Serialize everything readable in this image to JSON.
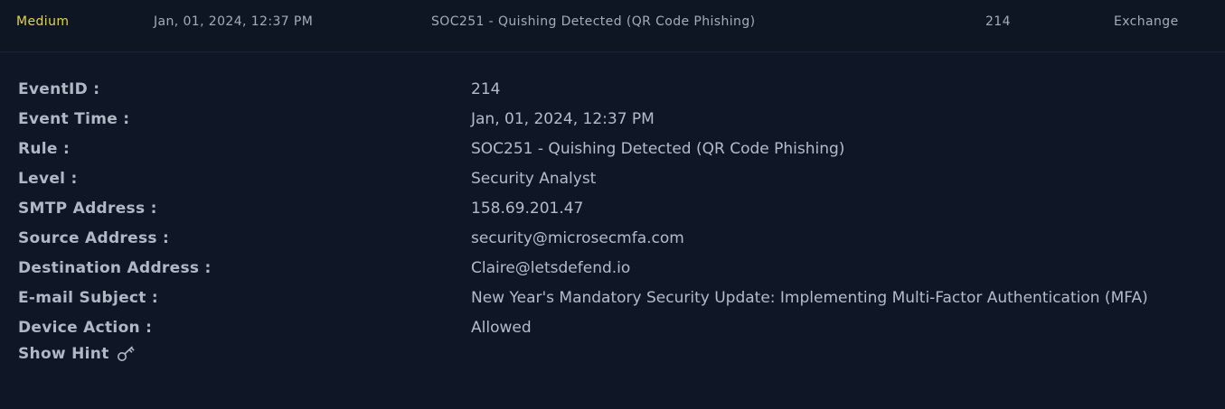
{
  "alert": {
    "level": "Medium",
    "time": "Jan, 01, 2024, 12:37 PM",
    "rule": "SOC251 - Quishing Detected (QR Code Phishing)",
    "event_id": "214",
    "type": "Exchange"
  },
  "details": [
    {
      "label": "EventID :",
      "value": "214"
    },
    {
      "label": "Event Time :",
      "value": "Jan, 01, 2024, 12:37 PM"
    },
    {
      "label": "Rule :",
      "value": "SOC251 - Quishing Detected (QR Code Phishing)"
    },
    {
      "label": "Level :",
      "value": "Security Analyst"
    },
    {
      "label": "SMTP Address :",
      "value": "158.69.201.47"
    },
    {
      "label": "Source Address :",
      "value": "security@microsecmfa.com"
    },
    {
      "label": "Destination Address :",
      "value": "Claire@letsdefend.io"
    },
    {
      "label": "E-mail Subject :",
      "value": "New Year's Mandatory Security Update: Implementing Multi-Factor Authentication (MFA)"
    },
    {
      "label": "Device Action :",
      "value": "Allowed"
    }
  ],
  "hint": {
    "label": "Show Hint",
    "icon": "key-icon"
  },
  "colors": {
    "background": "#0f1726",
    "level_medium": "#e7d53a",
    "text": "#aeb6c4"
  }
}
